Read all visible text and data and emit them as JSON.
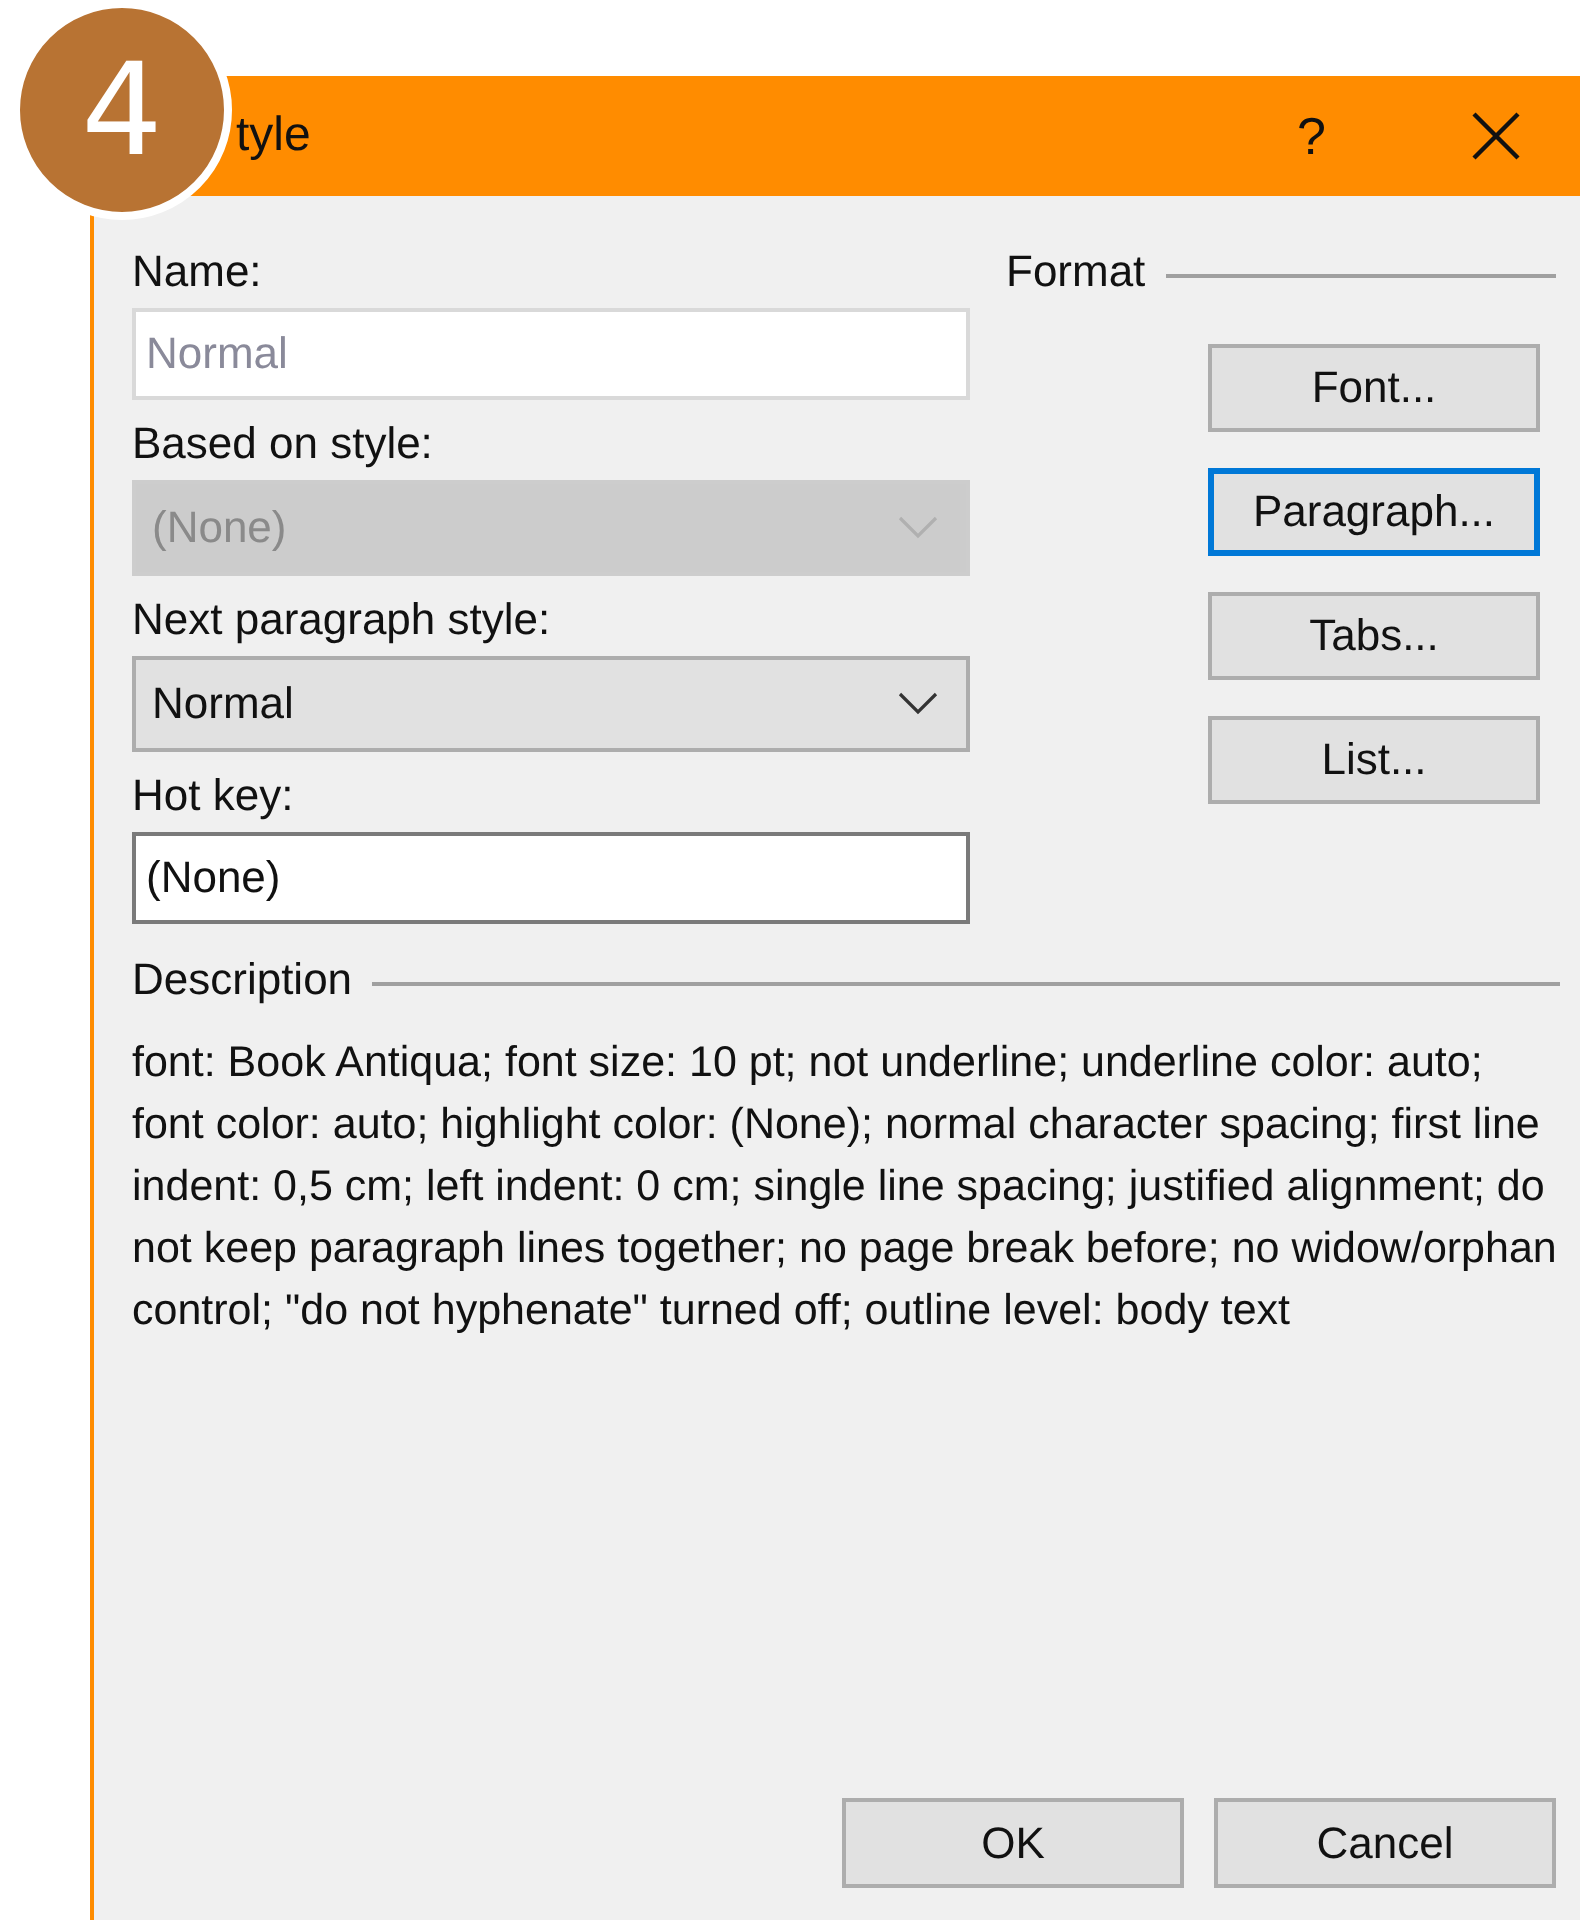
{
  "step_badge": "4",
  "window": {
    "title": "tyle",
    "help": "?"
  },
  "fields": [
    {
      "label": "Name:",
      "kind": "text",
      "value": "Normal",
      "disabled": true
    },
    {
      "label": "Based on style:",
      "kind": "select",
      "value": "(None)",
      "disabled": true
    },
    {
      "label": "Next paragraph style:",
      "kind": "select",
      "value": "Normal",
      "disabled": false
    },
    {
      "label": "Hot key:",
      "kind": "text",
      "value": "(None)",
      "disabled": false
    }
  ],
  "format": {
    "heading": "Format",
    "buttons": [
      {
        "label": "Font...",
        "focused": false
      },
      {
        "label": "Paragraph...",
        "focused": true
      },
      {
        "label": "Tabs...",
        "focused": false
      },
      {
        "label": "List...",
        "focused": false
      }
    ]
  },
  "description": {
    "heading": "Description",
    "text": "font: Book Antiqua; font size: 10 pt; not underline; underline color: auto; font color: auto; highlight color: (None); normal character spacing; first line indent: 0,5 cm; left indent: 0 cm; single line spacing; justified alignment; do not keep paragraph lines together; no page break before; no widow/orphan control; \"do not hyphenate\" turned off; outline level: body text"
  },
  "buttons": [
    "OK",
    "Cancel"
  ]
}
